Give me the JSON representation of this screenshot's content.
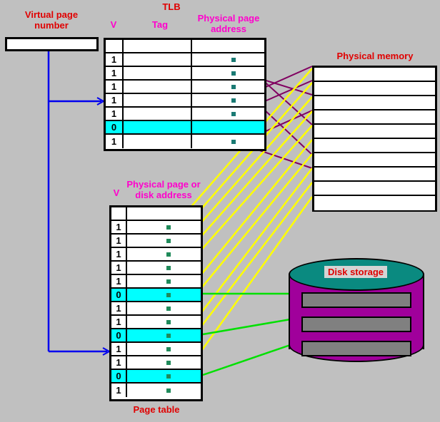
{
  "diagram": {
    "background_color": "#c0c0c0",
    "title_color": "#e00000",
    "header_color": "#ff00cc"
  },
  "virtual_page": {
    "title": "Virtual page\nnumber",
    "value": ""
  },
  "tlb": {
    "title": "TLB",
    "headers": {
      "valid": "V",
      "tag": "Tag",
      "physical_page_address": "Physical page\naddress"
    },
    "rows": [
      {
        "valid": "",
        "tag": "",
        "ppa": "",
        "invalid": false,
        "dot": false
      },
      {
        "valid": "1",
        "tag": "",
        "ppa": "",
        "invalid": false,
        "dot": true
      },
      {
        "valid": "1",
        "tag": "",
        "ppa": "",
        "invalid": false,
        "dot": true
      },
      {
        "valid": "1",
        "tag": "",
        "ppa": "",
        "invalid": false,
        "dot": true
      },
      {
        "valid": "1",
        "tag": "",
        "ppa": "",
        "invalid": false,
        "dot": true
      },
      {
        "valid": "1",
        "tag": "",
        "ppa": "",
        "invalid": false,
        "dot": true
      },
      {
        "valid": "0",
        "tag": "",
        "ppa": "",
        "invalid": true,
        "dot": false
      },
      {
        "valid": "1",
        "tag": "",
        "ppa": "",
        "invalid": false,
        "dot": true
      }
    ]
  },
  "physical_memory": {
    "title": "Physical memory",
    "rows": [
      "",
      "",
      "",
      "",
      "",
      "",
      "",
      "",
      "",
      ""
    ]
  },
  "page_table": {
    "title": "Page  table",
    "headers": {
      "valid": "V",
      "physical_page_or_disk_address": "Physical page or\ndisk address"
    },
    "rows": [
      {
        "valid": "",
        "addr": "",
        "invalid": false,
        "dot": false
      },
      {
        "valid": "1",
        "addr": "",
        "invalid": false,
        "dot": true
      },
      {
        "valid": "1",
        "addr": "",
        "invalid": false,
        "dot": true
      },
      {
        "valid": "1",
        "addr": "",
        "invalid": false,
        "dot": true
      },
      {
        "valid": "1",
        "addr": "",
        "invalid": false,
        "dot": true
      },
      {
        "valid": "1",
        "addr": "",
        "invalid": false,
        "dot": true
      },
      {
        "valid": "0",
        "addr": "",
        "invalid": true,
        "dot": true
      },
      {
        "valid": "1",
        "addr": "",
        "invalid": false,
        "dot": true
      },
      {
        "valid": "1",
        "addr": "",
        "invalid": false,
        "dot": true
      },
      {
        "valid": "0",
        "addr": "",
        "invalid": true,
        "dot": true
      },
      {
        "valid": "1",
        "addr": "",
        "invalid": false,
        "dot": true
      },
      {
        "valid": "1",
        "addr": "",
        "invalid": false,
        "dot": true
      },
      {
        "valid": "0",
        "addr": "",
        "invalid": true,
        "dot": true
      },
      {
        "valid": "1",
        "addr": "",
        "invalid": false,
        "dot": true
      }
    ]
  },
  "disk_storage": {
    "title": "Disk storage",
    "platters": [
      "",
      "",
      ""
    ]
  },
  "connectors": {
    "lookup_color": "#0000ee",
    "tlb_hit_color": "#800060",
    "page_table_hit_color": "#ffff00",
    "page_fault_color": "#00e000"
  }
}
